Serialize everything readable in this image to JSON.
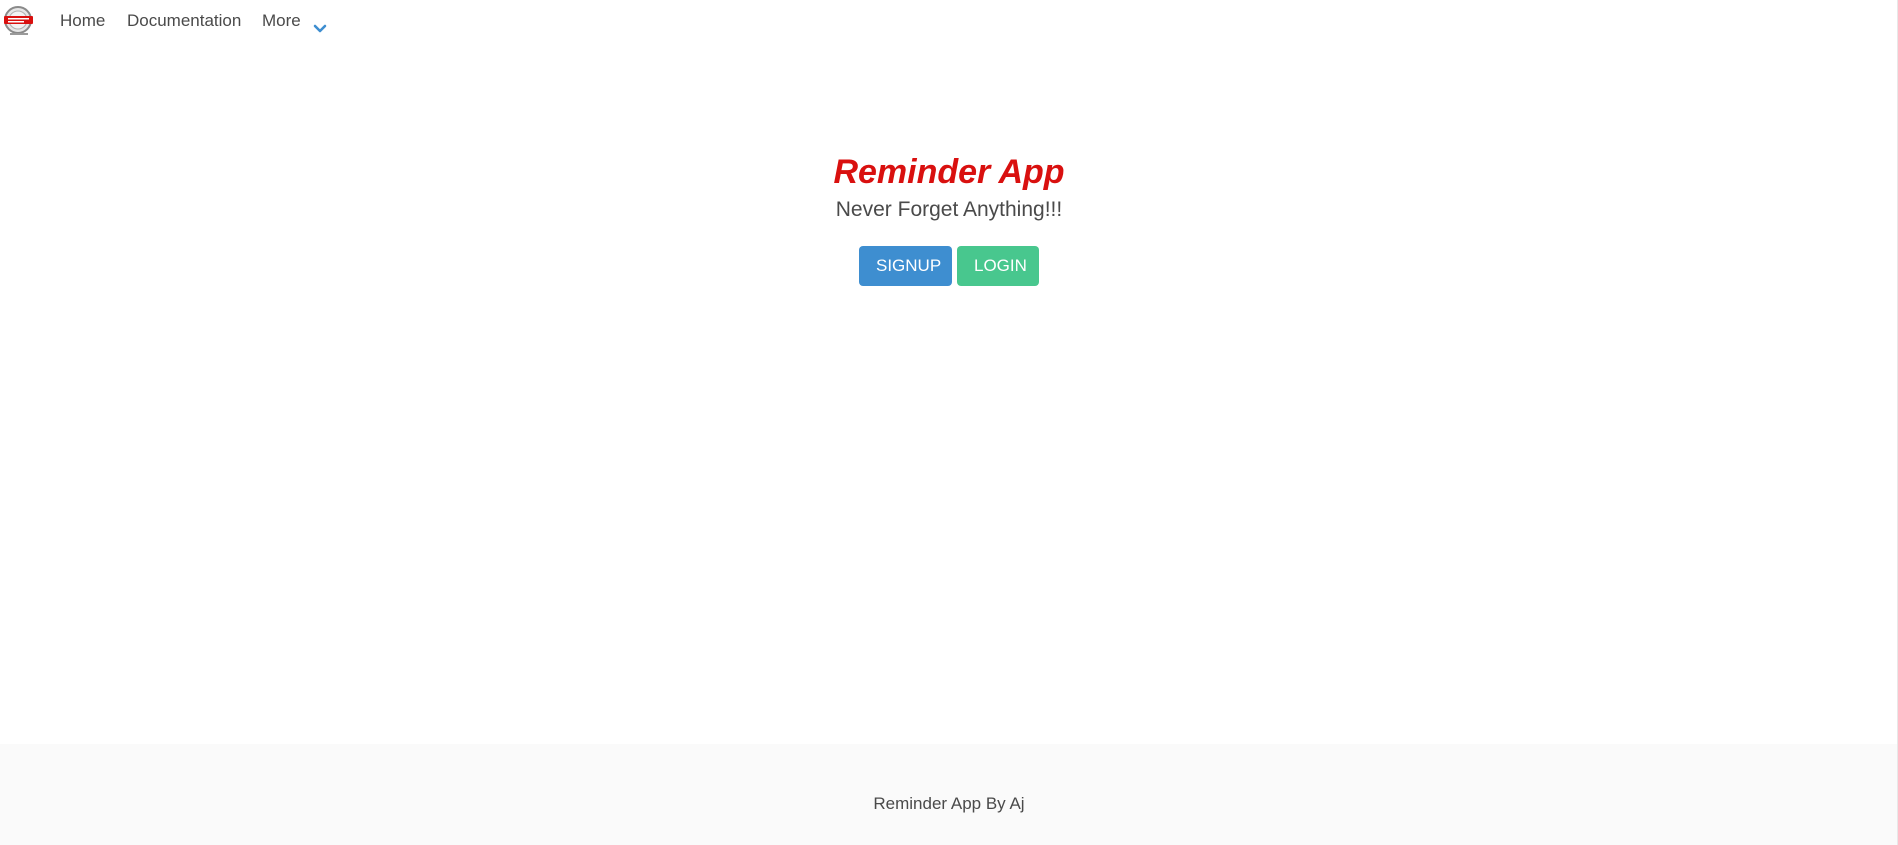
{
  "navbar": {
    "logo_icon": "reminder-app-logo",
    "links": {
      "home": "Home",
      "documentation": "Documentation",
      "more": "More"
    },
    "more_icon": "chevron-down-icon"
  },
  "hero": {
    "title": "Reminder App",
    "subtitle": "Never Forget Anything!!!",
    "signup_label": "SIGNUP",
    "login_label": "LOGIN"
  },
  "footer": {
    "text": "Reminder App By Aj"
  },
  "colors": {
    "title": "#d9100f",
    "signup_button": "#3e8ed0",
    "login_button": "#48c78e",
    "chevron": "#3e8ed0",
    "footer_background": "#fafafa"
  }
}
